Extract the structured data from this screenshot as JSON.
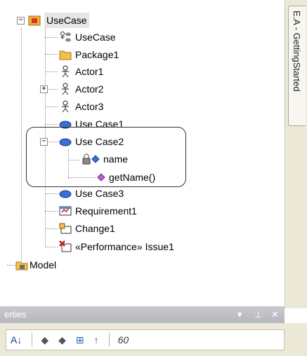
{
  "tree": {
    "root_label": "UseCase",
    "items": [
      {
        "label": "UseCase"
      },
      {
        "label": "Package1"
      },
      {
        "label": "Actor1"
      },
      {
        "label": "Actor2"
      },
      {
        "label": "Actor3"
      },
      {
        "label": "Use Case1"
      },
      {
        "label": "Use Case2"
      },
      {
        "label": "name"
      },
      {
        "label": "getName()"
      },
      {
        "label": "Use Case3"
      },
      {
        "label": "Requirement1"
      },
      {
        "label": "Change1"
      },
      {
        "label": "«Performance» Issue1"
      }
    ],
    "model_label": "Model",
    "expander_collapsed": "+",
    "expander_expanded": "−"
  },
  "side_tab": {
    "label": "E.A - GettingStarted"
  },
  "properties": {
    "title": "erties",
    "dropdown_glyph": "▾",
    "pin_glyph": "⊥",
    "close_glyph": "✕",
    "toolbar": [
      "A↓",
      "◆",
      "◆",
      "⊞",
      "↑",
      "60"
    ]
  },
  "colors": {
    "selection": "#e6e6e6",
    "panel": "#ece9d8",
    "header": "#b4b6bd",
    "usecase_blue": "#3a6fd8"
  }
}
